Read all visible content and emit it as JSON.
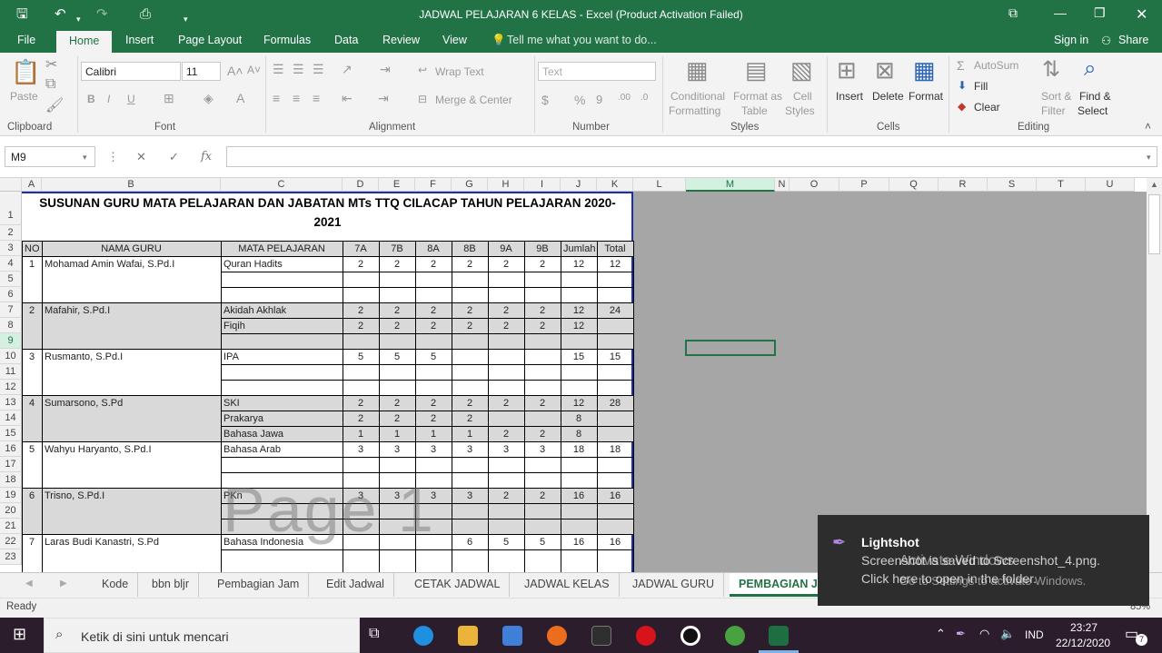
{
  "window": {
    "title": "JADWAL PELAJARAN 6 KELAS  -  Excel (Product Activation Failed)"
  },
  "ribbon_tabs": [
    "File",
    "Home",
    "Insert",
    "Page Layout",
    "Formulas",
    "Data",
    "Review",
    "View"
  ],
  "tell_me": "Tell me what you want to do...",
  "account": {
    "signin": "Sign in",
    "share": "Share"
  },
  "clipboard": {
    "label": "Clipboard",
    "paste": "Paste"
  },
  "font": {
    "label": "Font",
    "name": "Calibri",
    "size": "11"
  },
  "alignment": {
    "label": "Alignment",
    "wrap": "Wrap Text",
    "merge": "Merge & Center"
  },
  "number": {
    "label": "Number",
    "format": "Text"
  },
  "styles": {
    "label": "Styles",
    "cond1": "Conditional",
    "cond2": "Formatting",
    "fmt1": "Format as",
    "fmt2": "Table",
    "cell1": "Cell",
    "cell2": "Styles"
  },
  "cells": {
    "label": "Cells",
    "insert": "Insert",
    "delete": "Delete",
    "format": "Format"
  },
  "editing": {
    "label": "Editing",
    "autosum": "AutoSum",
    "fill": "Fill",
    "clear": "Clear",
    "sort1": "Sort &",
    "sort2": "Filter",
    "find1": "Find &",
    "find2": "Select"
  },
  "formula_bar": {
    "name_box": "M9",
    "fx": "fx"
  },
  "columns": [
    "A",
    "B",
    "C",
    "D",
    "E",
    "F",
    "G",
    "H",
    "I",
    "J",
    "K",
    "L",
    "M",
    "N",
    "O",
    "P",
    "Q",
    "R",
    "S",
    "T",
    "U"
  ],
  "rows": [
    "1",
    "2",
    "3",
    "4",
    "5",
    "6",
    "7",
    "8",
    "9",
    "10",
    "11",
    "12",
    "13",
    "14",
    "15",
    "16",
    "17",
    "18",
    "19",
    "20",
    "21",
    "22",
    "23"
  ],
  "sheet": {
    "title1": "SUSUNAN GURU MATA PELAJARAN DAN JABATAN MTs TTQ CILACAP TAHUN PELAJARAN 2020-",
    "title2": "2021",
    "headers": [
      "NO",
      "NAMA GURU",
      "MATA PELAJARAN",
      "7A",
      "7B",
      "8A",
      "8B",
      "9A",
      "9B",
      "Jumlah",
      "Total"
    ],
    "table": [
      {
        "row": 4,
        "no": "1",
        "nama": "Mohamad Amin Wafai, S.Pd.I",
        "mapel": "Quran Hadits",
        "v": [
          "2",
          "2",
          "2",
          "2",
          "2",
          "2"
        ],
        "jumlah": "12",
        "total": "12"
      },
      {
        "row": 7,
        "no": "2",
        "nama": "Mafahir, S.Pd.I",
        "mapel": "Akidah Akhlak",
        "v": [
          "2",
          "2",
          "2",
          "2",
          "2",
          "2"
        ],
        "jumlah": "12",
        "total": "24"
      },
      {
        "row": 8,
        "no": "",
        "nama": "",
        "mapel": "Fiqih",
        "v": [
          "2",
          "2",
          "2",
          "2",
          "2",
          "2"
        ],
        "jumlah": "12",
        "total": ""
      },
      {
        "row": 10,
        "no": "3",
        "nama": "Rusmanto, S.Pd.I",
        "mapel": "IPA",
        "v": [
          "5",
          "5",
          "5",
          "",
          "",
          ""
        ],
        "jumlah": "15",
        "total": "15"
      },
      {
        "row": 13,
        "no": "4",
        "nama": "Sumarsono, S.Pd",
        "mapel": "SKI",
        "v": [
          "2",
          "2",
          "2",
          "2",
          "2",
          "2"
        ],
        "jumlah": "12",
        "total": "28"
      },
      {
        "row": 14,
        "no": "",
        "nama": "",
        "mapel": "Prakarya",
        "v": [
          "2",
          "2",
          "2",
          "2",
          "",
          ""
        ],
        "jumlah": "8",
        "total": ""
      },
      {
        "row": 15,
        "no": "",
        "nama": "",
        "mapel": "Bahasa Jawa",
        "v": [
          "1",
          "1",
          "1",
          "1",
          "2",
          "2"
        ],
        "jumlah": "8",
        "total": ""
      },
      {
        "row": 16,
        "no": "5",
        "nama": "Wahyu Haryanto, S.Pd.I",
        "mapel": "Bahasa Arab",
        "v": [
          "3",
          "3",
          "3",
          "3",
          "3",
          "3"
        ],
        "jumlah": "18",
        "total": "18"
      },
      {
        "row": 19,
        "no": "6",
        "nama": "Trisno, S.Pd.I",
        "mapel": "PKn",
        "v": [
          "3",
          "3",
          "3",
          "3",
          "2",
          "2"
        ],
        "jumlah": "16",
        "total": "16"
      },
      {
        "row": 22,
        "no": "7",
        "nama": "Laras Budi Kanastri, S.Pd",
        "mapel": "Bahasa Indonesia",
        "v": [
          "",
          "",
          "",
          "6",
          "5",
          "5"
        ],
        "jumlah": "16",
        "total": "16"
      }
    ],
    "watermark": "Page 1"
  },
  "sheet_tabs": [
    "Kode",
    "bbn bljr",
    "Pembagian Jam",
    "Edit Jadwal",
    "CETAK JADWAL",
    "JADWAL KELAS",
    "JADWAL GURU",
    "PEMBAGIAN J"
  ],
  "status": {
    "ready": "Ready",
    "zoom": "85%"
  },
  "taskbar": {
    "search": "Ketik di sini untuk mencari",
    "lang": "IND",
    "time": "23:27",
    "date": "22/12/2020",
    "notif_count": "7"
  },
  "notification": {
    "app": "Lightshot",
    "line1": "Screenshot is saved to Screenshot_4.png.",
    "line2": "Click here to open in the folder."
  },
  "watermark_activate": {
    "line1": "Activate Windows",
    "line2": "Go to Settings to activate Windows."
  }
}
